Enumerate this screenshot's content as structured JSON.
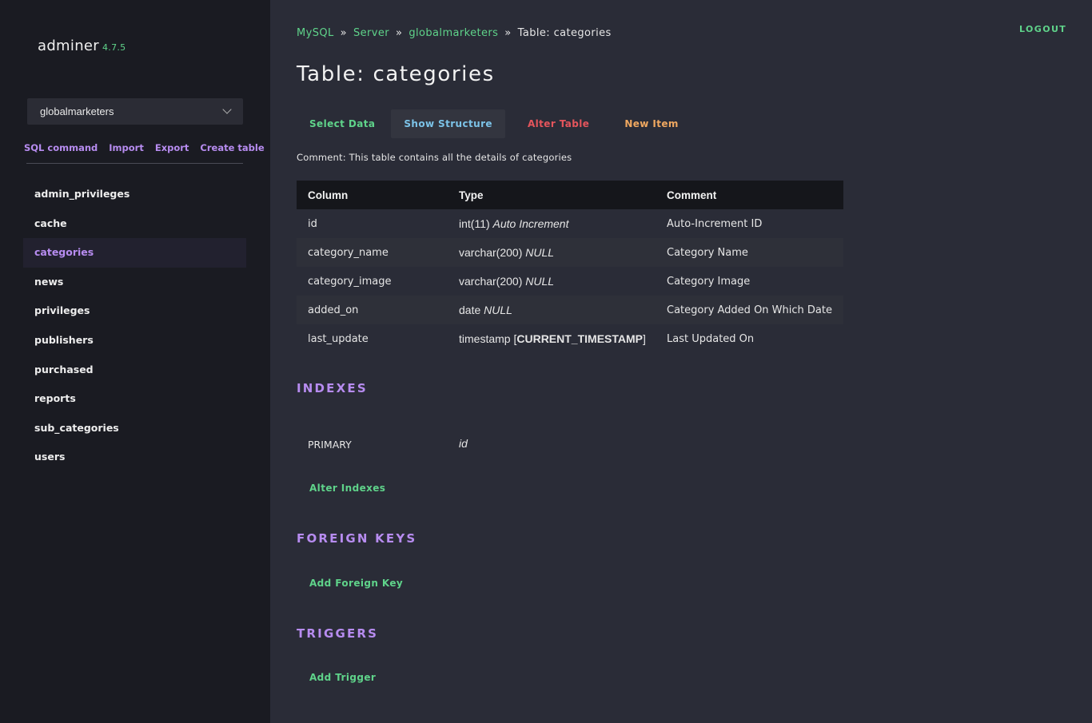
{
  "app": {
    "name": "adminer",
    "version": "4.7.5"
  },
  "sidebar": {
    "database": "globalmarketers",
    "links": [
      "SQL command",
      "Import",
      "Export",
      "Create table"
    ],
    "tables": [
      "admin_privileges",
      "cache",
      "categories",
      "news",
      "privileges",
      "publishers",
      "purchased",
      "reports",
      "sub_categories",
      "users"
    ],
    "active_table": "categories"
  },
  "header": {
    "logout": "LOGOUT"
  },
  "breadcrumb": {
    "items": [
      "MySQL",
      "Server",
      "globalmarketers"
    ],
    "separator": "»",
    "current": "Table: categories"
  },
  "title": "Table: categories",
  "tabs": [
    "Select Data",
    "Show Structure",
    "Alter Table",
    "New Item"
  ],
  "comment": "Comment: This table contains all the details of categories",
  "structure": {
    "headers": [
      "Column",
      "Type",
      "Comment"
    ],
    "rows": [
      {
        "column": "id",
        "type": "int(11)",
        "type_extra": "Auto Increment",
        "type_default": "",
        "comment": "Auto-Increment ID"
      },
      {
        "column": "category_name",
        "type": "varchar(200)",
        "type_extra": "NULL",
        "type_default": "",
        "comment": "Category Name"
      },
      {
        "column": "category_image",
        "type": "varchar(200)",
        "type_extra": "NULL",
        "type_default": "",
        "comment": "Category Image"
      },
      {
        "column": "added_on",
        "type": "date",
        "type_extra": "NULL",
        "type_default": "",
        "comment": "Category Added On Which Date"
      },
      {
        "column": "last_update",
        "type": "timestamp",
        "type_extra": "",
        "type_default": "CURRENT_TIMESTAMP",
        "comment": "Last Updated On"
      }
    ]
  },
  "indexes": {
    "title": "INDEXES",
    "type": "PRIMARY",
    "columns": "id",
    "action": "Alter Indexes"
  },
  "foreign_keys": {
    "title": "FOREIGN KEYS",
    "action": "Add Foreign Key"
  },
  "triggers": {
    "title": "TRIGGERS",
    "action": "Add Trigger"
  },
  "colors": {
    "accent_purple": "#b78cf0",
    "accent_green": "#5fd38a",
    "accent_blue": "#7cc3e8",
    "accent_red": "#e5555c",
    "accent_orange": "#f0a860"
  }
}
